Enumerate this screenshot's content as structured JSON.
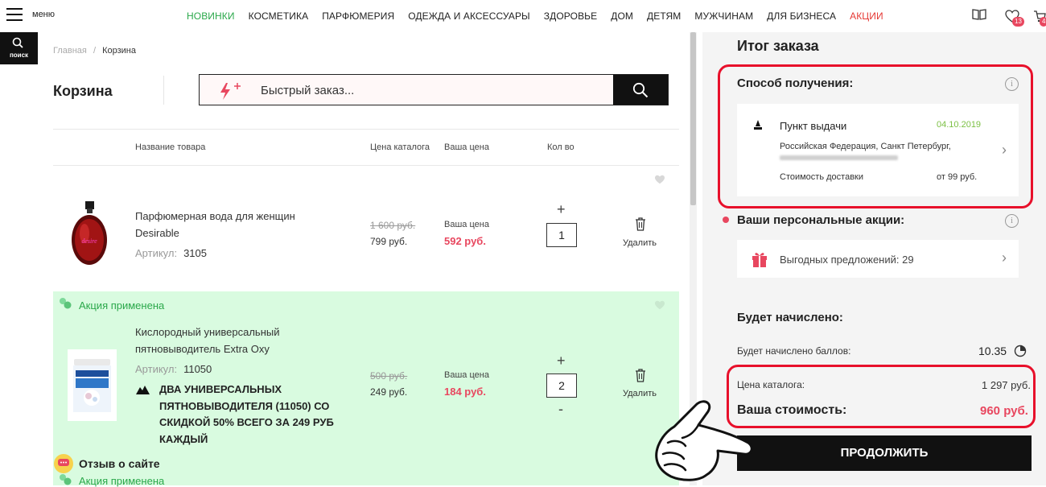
{
  "header": {
    "menu_label": "меню",
    "nav": [
      {
        "label": "НОВИНКИ",
        "color": "green"
      },
      {
        "label": "КОСМЕТИКА",
        "color": "default"
      },
      {
        "label": "ПАРФЮМЕРИЯ",
        "color": "default"
      },
      {
        "label": "ОДЕЖДА И АКСЕССУАРЫ",
        "color": "default"
      },
      {
        "label": "ЗДОРОВЬЕ",
        "color": "default"
      },
      {
        "label": "ДОМ",
        "color": "default"
      },
      {
        "label": "ДЕТЯМ",
        "color": "default"
      },
      {
        "label": "МУЖЧИНАМ",
        "color": "default"
      },
      {
        "label": "ДЛЯ БИЗНЕСА",
        "color": "default"
      },
      {
        "label": "АКЦИИ",
        "color": "red"
      }
    ],
    "wishlist_count": "13",
    "cart_count": "4",
    "search_label": "поиск"
  },
  "breadcrumb": {
    "home": "Главная",
    "sep": "/",
    "current": "Корзина"
  },
  "cart": {
    "title": "Корзина",
    "quick_order_placeholder": "Быстрый заказ...",
    "columns": {
      "name": "Название товара",
      "catalog_price": "Цена каталога",
      "your_price": "Ваша цена",
      "qty": "Кол во"
    },
    "your_price_label": "Ваша цена",
    "delete_label": "Удалить",
    "items": [
      {
        "name_line1": "Парфюмерная вода для женщин",
        "name_line2": "Desirable",
        "article_label": "Артикул:",
        "article": "3105",
        "old_price": "1 600 руб.",
        "catalog_price": "799 руб.",
        "your_price": "592 руб.",
        "qty": "1"
      },
      {
        "promo_label": "Акция применена",
        "name_line1": "Кислородный универсальный",
        "name_line2": "пятновыводитель Extra Oxy",
        "article_label": "Артикул:",
        "article": "11050",
        "promo_text": "ДВА УНИВЕРСАЛЬНЫХ ПЯТНОВЫВОДИТЕЛЯ (11050) СО СКИДКОЙ 50% ВСЕГО ЗА 249 РУБ КАЖДЫЙ",
        "old_price": "500 руб.",
        "catalog_price": "249 руб.",
        "your_price": "184 руб.",
        "qty": "2"
      }
    ],
    "next_promo_label": "Акция применена",
    "review_label": "Отзыв о сайте"
  },
  "summary": {
    "title": "Итог заказа",
    "delivery_title": "Способ получения:",
    "pickup_label": "Пункт выдачи",
    "pickup_date": "04.10.2019",
    "pickup_address": "Российская Федерация, Санкт Петербург,",
    "delivery_cost_label": "Стоимость доставки",
    "delivery_cost": "от 99 руб.",
    "personal_title": "Ваши персональные акции:",
    "offers_label": "Выгодных предложений: 29",
    "accrued_title": "Будет начислено:",
    "points_label": "Будет начислено баллов:",
    "points_value": "10.35",
    "catalog_price_label": "Цена каталога:",
    "catalog_price_value": "1 297 руб.",
    "your_cost_label": "Ваша стоимость:",
    "your_cost_value": "960 руб.",
    "continue_label": "ПРОДОЛЖИТЬ"
  },
  "colors": {
    "accent_pink": "#e8475f",
    "green": "#2aa84a",
    "highlight_red": "#e8102b",
    "promo_bg": "#d9fbe0"
  }
}
